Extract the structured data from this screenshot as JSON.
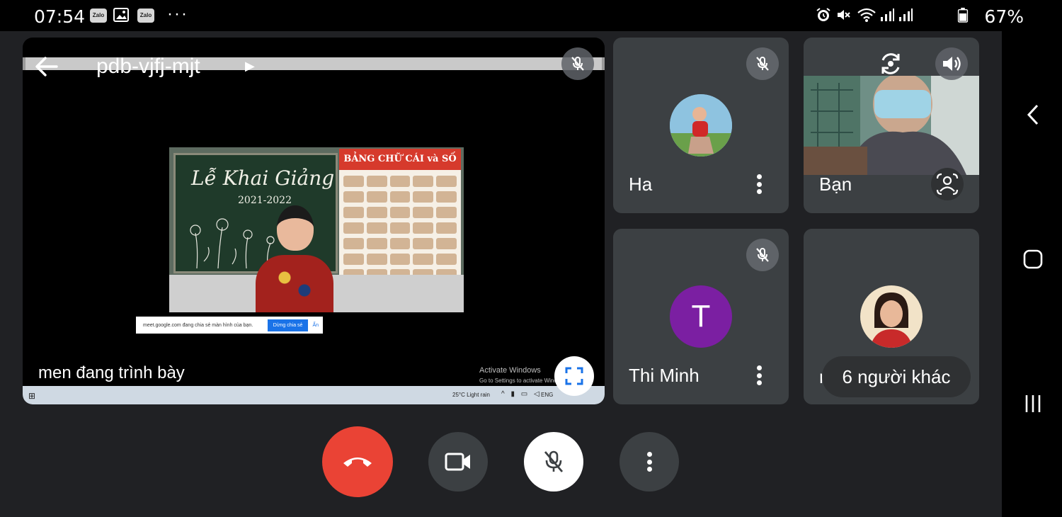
{
  "status_bar": {
    "time": "07:54",
    "notification_icons": [
      "zalo-icon",
      "gallery-icon",
      "zalo-icon"
    ],
    "zalo_label": "Zalo",
    "more": "···",
    "right_icons": [
      "alarm-icon",
      "mute-icon",
      "wifi-icon",
      "signal-icon",
      "signal-icon"
    ],
    "battery_percent": "67%",
    "battery_level": 0.67
  },
  "main": {
    "meeting_code": "pdb-vjfj-mjt",
    "presenting_label": "men đang trình bày",
    "shared_screen": {
      "chalkboard_title": "Lễ Khai Giảng",
      "chalkboard_year": "2021-2022",
      "poster_title": "BẢNG CHỮ CÁI và SỐ",
      "share_notice": "meet.google.com đang chia sẻ màn hình của bạn.",
      "stop_share_label": "Dừng chia sẻ",
      "hide_label": "Ẩn",
      "activate_title": "Activate Windows",
      "activate_sub": "Go to Settings to activate Windows.",
      "weather": "25°C  Light rain",
      "language": "ENG"
    }
  },
  "participants": [
    {
      "name": "Ha",
      "muted": true
    },
    {
      "name": "Bạn",
      "muted": false
    },
    {
      "name": "Thi Minh",
      "initial": "T",
      "avatar_color": "#7b1fa2",
      "muted": true
    },
    {
      "name": "m",
      "others_label": "6 người khác"
    }
  ],
  "controls": {
    "end_call_color": "#ea4335",
    "camera_on": true,
    "mic_muted": true
  },
  "colors": {
    "background": "#202124",
    "tile": "#3c4043",
    "accent": "#1a73e8"
  }
}
